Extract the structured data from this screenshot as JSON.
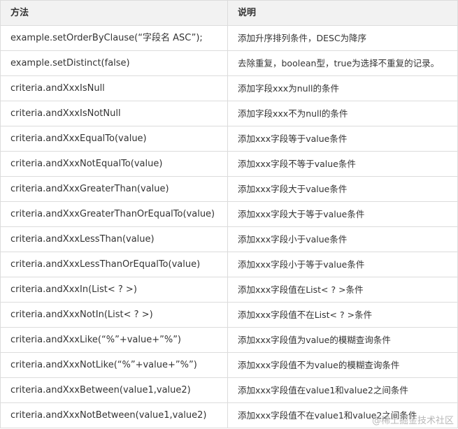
{
  "table": {
    "headers": [
      "方法",
      "说明"
    ],
    "rows": [
      [
        "example.setOrderByClause(“字段名 ASC”);",
        "添加升序排列条件，DESC为降序"
      ],
      [
        "example.setDistinct(false)",
        "去除重复，boolean型，true为选择不重复的记录。"
      ],
      [
        "criteria.andXxxIsNull",
        "添加字段xxx为null的条件"
      ],
      [
        "criteria.andXxxIsNotNull",
        "添加字段xxx不为null的条件"
      ],
      [
        "criteria.andXxxEqualTo(value)",
        "添加xxx字段等于value条件"
      ],
      [
        "criteria.andXxxNotEqualTo(value)",
        "添加xxx字段不等于value条件"
      ],
      [
        "criteria.andXxxGreaterThan(value)",
        "添加xxx字段大于value条件"
      ],
      [
        "criteria.andXxxGreaterThanOrEqualTo(value)",
        "添加xxx字段大于等于value条件"
      ],
      [
        "criteria.andXxxLessThan(value)",
        "添加xxx字段小于value条件"
      ],
      [
        "criteria.andXxxLessThanOrEqualTo(value)",
        "添加xxx字段小于等于value条件"
      ],
      [
        "criteria.andXxxIn(List< ? >)",
        "添加xxx字段值在List< ? >条件"
      ],
      [
        "criteria.andXxxNotIn(List< ? >)",
        "添加xxx字段值不在List< ? >条件"
      ],
      [
        "criteria.andXxxLike(“%”+value+”%”)",
        "添加xxx字段值为value的模糊查询条件"
      ],
      [
        "criteria.andXxxNotLike(“%”+value+”%”)",
        "添加xxx字段值不为value的模糊查询条件"
      ],
      [
        "criteria.andXxxBetween(value1,value2)",
        "添加xxx字段值在value1和value2之间条件"
      ],
      [
        "criteria.andXxxNotBetween(value1,value2)",
        "添加xxx字段值不在value1和value2之间条件"
      ]
    ]
  },
  "watermark": "@稀土掘金技术社区"
}
